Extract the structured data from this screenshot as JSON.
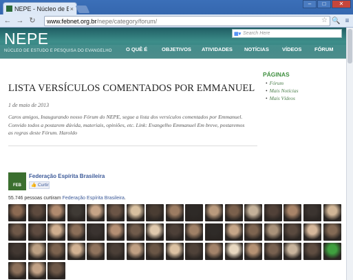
{
  "browser": {
    "tab_title": "NEPE - Núcleo de Estudo e P",
    "tab_close": "×",
    "url_domain": "www.febnet.org.br",
    "url_path": "/nepe/category/forum/",
    "window_buttons": [
      "–",
      "□",
      "✕"
    ]
  },
  "site": {
    "logo": "NEPE",
    "logo_subtitle": "NÚCLEO DE ESTUDO E PESQUISA DO EVANGELHO",
    "search_placeholder": "Search Here",
    "nav": [
      "O QUÊ É",
      "OBJETIVOS",
      "ATIVIDADES",
      "NOTÍCIAS",
      "VÍDEOS",
      "FÓRUM"
    ]
  },
  "post": {
    "title": "LISTA VERSÍCULOS COMENTADOS POR EMMANUEL",
    "date": "1 de maio de 2013",
    "body": "Caros amigos, Inaugurando nosso Fórum do NEPE, segue a lista dos versículos comentados por Emmanuel. Convido todos a postarem dúvida, materiais, opiniões, etc. Link: Evangelho Emmanuel Em breve, postaremos as regras deste Fórum. Haroldo"
  },
  "sidebar": {
    "title": "PÁGINAS",
    "items": [
      "Fórum",
      "Mais Notícias",
      "Mais Vídeos"
    ]
  },
  "facebook": {
    "logo_text": "FEB",
    "page_name": "Federação Espírita Brasileira",
    "like_button": "Curtir",
    "count_text": "55.746 pessoas curtiram",
    "count_link": "Federação Espírita Brasileira",
    "count_suffix": ".",
    "face_colors": [
      "#8b6a52",
      "#5d4a3e",
      "#b08a6e",
      "#3f3a35",
      "#c7a487",
      "#6b5546",
      "#d8c0a0",
      "#4a3d33",
      "#9c7c62",
      "#2e2a27",
      "#b99a7d",
      "#7a604c",
      "#c4b199",
      "#514138",
      "#a88468",
      "#3b3430",
      "#d0b596",
      "#6e5848",
      "#5e4b40",
      "#cfae8f",
      "#8a6e58",
      "#3a3330",
      "#b48f73",
      "#705b4b",
      "#e0c9ad",
      "#4d4038",
      "#9f8066",
      "#2f2b28",
      "#c6a688",
      "#7d6450",
      "#a9927a",
      "#5a4a3f",
      "#d6b89b",
      "#846a55",
      "#423832",
      "#bca083",
      "#7b624e",
      "#d2b293",
      "#8f735d",
      "#4b3f37",
      "#c0a083",
      "#6a5646",
      "#dcc2a3",
      "#4f4239",
      "#a3836a",
      "#e8d8c0",
      "#b59274",
      "#786150",
      "#c9b59d",
      "#5f4d41",
      "#3fa03f",
      "#8c705a",
      "#c2a286",
      "#6c5747"
    ]
  }
}
